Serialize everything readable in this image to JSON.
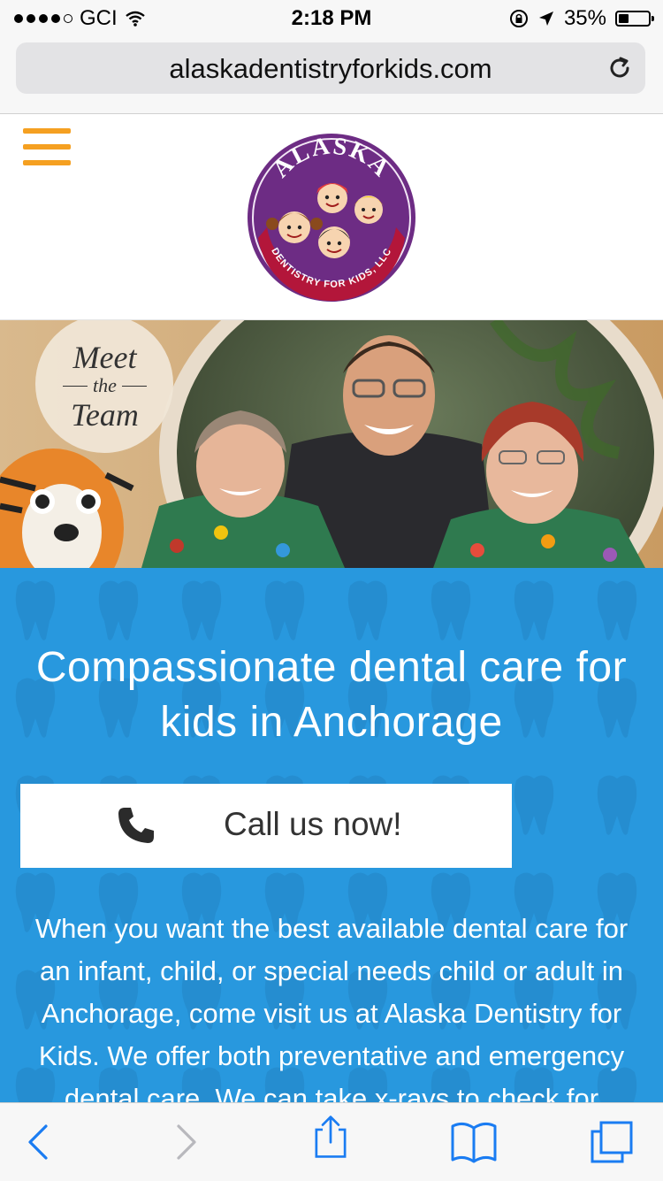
{
  "status_bar": {
    "carrier": "GCI",
    "time": "2:18 PM",
    "battery_percent": "35%",
    "battery_level": 0.35,
    "signal_bars_filled": 4,
    "signal_bars_total": 5
  },
  "browser": {
    "url": "alaskadentistryforkids.com",
    "icons": {
      "reload": "reload-icon",
      "back": "back-icon",
      "forward": "forward-icon",
      "share": "share-icon",
      "bookmarks": "bookmarks-icon",
      "tabs": "tabs-icon"
    }
  },
  "header": {
    "menu_icon": "hamburger-menu-icon",
    "logo": {
      "top_text": "ALASKA",
      "bottom_text": "DENTISTRY FOR KIDS, LLC"
    }
  },
  "hero": {
    "badge_line1": "Meet",
    "badge_line2": "the",
    "badge_line3": "Team"
  },
  "main": {
    "heading": "Compassionate dental care for kids in Anchorage",
    "call_button_label": "Call us now!",
    "call_icon": "phone-icon",
    "intro_text": "When you want the best available dental care for an infant, child, or special needs child or adult in Anchorage, come visit us at Alaska Dentistry for Kids. We offer both preventative and emergency dental care. We can take x-rays to check for"
  },
  "colors": {
    "accent_orange": "#f5a021",
    "section_blue": "#2898de",
    "logo_purple": "#6d2c84",
    "logo_red": "#b3163a"
  }
}
